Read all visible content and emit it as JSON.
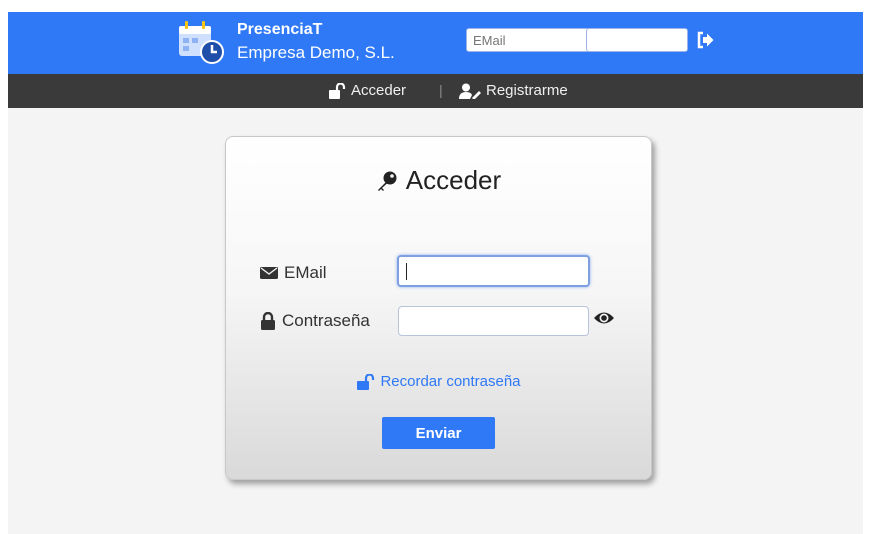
{
  "header": {
    "app_name": "PresenciaT",
    "company": "Empresa Demo, S.L.",
    "email_placeholder": "EMail",
    "password_placeholder": "",
    "login_icon": "sign-in-icon",
    "colors": {
      "brand": "#2f79f6",
      "nav": "#3a3a3a"
    }
  },
  "nav": {
    "acceder": "Acceder",
    "separator": "|",
    "registrarme": "Registrarme"
  },
  "login_card": {
    "title": "Acceder",
    "email_label": "EMail",
    "email_value": "",
    "password_label": "Contraseña",
    "password_value": "",
    "remember_link": "Recordar contraseña",
    "submit_label": "Enviar"
  }
}
